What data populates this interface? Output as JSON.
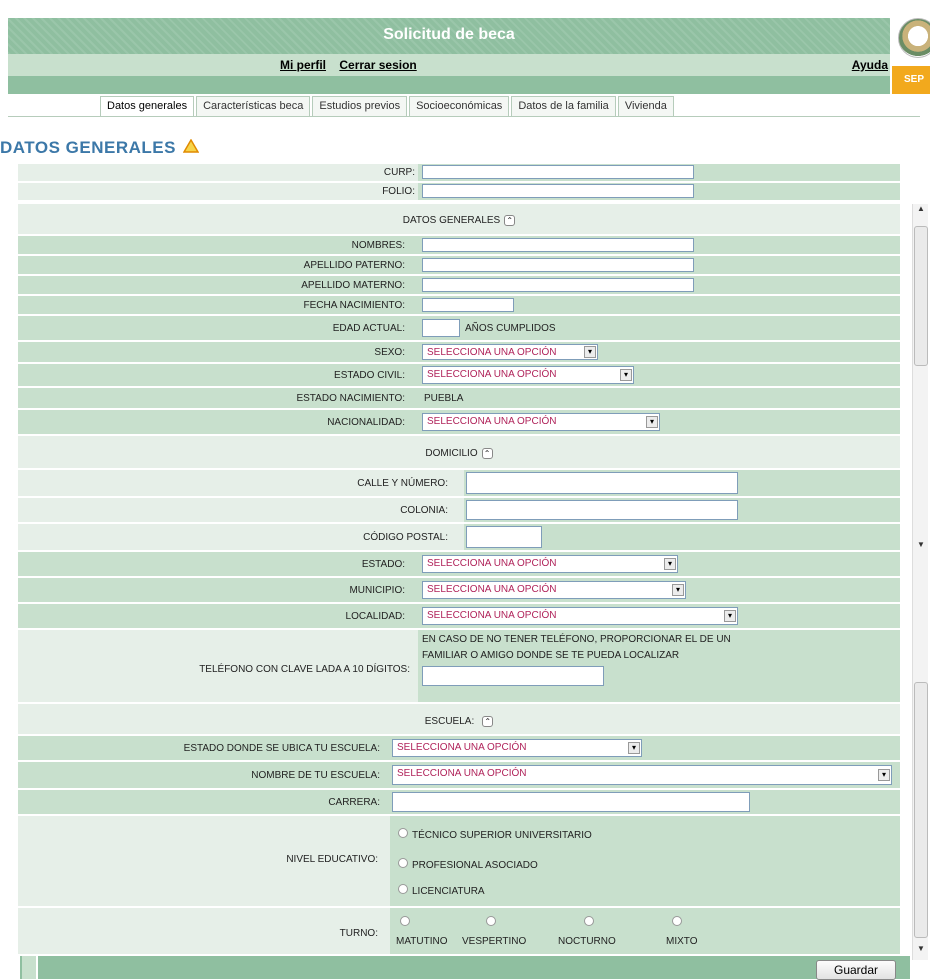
{
  "header": {
    "title": "Solicitud de beca",
    "nav": [
      "Mi perfil",
      "Cerrar sesion"
    ],
    "help": "Ayuda",
    "logo_strip_text": "SEP"
  },
  "tabs": [
    {
      "label": "Datos generales",
      "active": true
    },
    {
      "label": "Características beca"
    },
    {
      "label": "Estudios previos"
    },
    {
      "label": "Socioeconómicas"
    },
    {
      "label": "Datos de la familia"
    },
    {
      "label": "Vivienda"
    }
  ],
  "section_title": "DATOS GENERALES",
  "top": {
    "curp_label": "CURP:",
    "folio_label": "FOLIO:"
  },
  "personal": {
    "heading": "DATOS GENERALES",
    "nombres_label": "NOMBRES:",
    "apellido_paterno_label": "APELLIDO PATERNO:",
    "apellido_materno_label": "APELLIDO MATERNO:",
    "fecha_nacimiento_label": "FECHA NACIMIENTO:",
    "edad_label": "EDAD ACTUAL:",
    "edad_suffix": "AÑOS CUMPLIDOS",
    "sexo_label": "SEXO:",
    "sexo_value": "SELECCIONA UNA OPCIÓN",
    "estado_civil_label": "ESTADO CIVIL:",
    "estado_civil_value": "SELECCIONA UNA OPCIÓN",
    "estado_nacimiento_label": "ESTADO NACIMIENTO:",
    "estado_nacimiento_value": "PUEBLA",
    "nacionalidad_label": "NACIONALIDAD:",
    "nacionalidad_value": "SELECCIONA UNA OPCIÓN"
  },
  "domicilio": {
    "heading": "DOMICILIO",
    "calle_label": "CALLE Y NÚMERO:",
    "colonia_label": "COLONIA:",
    "cp_label": "CÓDIGO POSTAL:",
    "estado_label": "ESTADO:",
    "estado_value": "SELECCIONA UNA OPCIÓN",
    "municipio_label": "MUNICIPIO:",
    "municipio_value": "SELECCIONA UNA OPCIÓN",
    "localidad_label": "LOCALIDAD:",
    "localidad_value": "SELECCIONA UNA OPCIÓN",
    "telefono_label": "TELÉFONO CON CLAVE LADA A 10 DÍGITOS:",
    "telefono_note_1": "EN CASO DE NO TENER TELÉFONO, PROPORCIONAR EL DE UN",
    "telefono_note_2": "FAMILIAR O AMIGO DONDE SE TE PUEDA LOCALIZAR"
  },
  "escuela": {
    "heading": "ESCUELA:",
    "estado_label": "ESTADO DONDE SE UBICA TU ESCUELA:",
    "estado_value": "SELECCIONA UNA OPCIÓN",
    "nombre_label": "NOMBRE DE TU ESCUELA:",
    "nombre_value": "SELECCIONA UNA OPCIÓN",
    "carrera_label": "CARRERA:",
    "nivel_label": "NIVEL EDUCATIVO:",
    "nivel_options": [
      "TÉCNICO SUPERIOR UNIVERSITARIO",
      "PROFESIONAL ASOCIADO",
      "LICENCIATURA"
    ],
    "turno_label": "TURNO:",
    "turno_options": [
      "MATUTINO",
      "VESPERTINO",
      "NOCTURNO",
      "MIXTO"
    ]
  },
  "footer": {
    "save_label": "Guardar"
  },
  "colors": {
    "header_green": "#8fbfa0",
    "row_green": "#c8e0cd",
    "heading_blue": "#3c78a8",
    "select_text": "#b0235a",
    "warning_orange": "#f2a91d"
  },
  "icons": [
    "warning-icon",
    "collapse-icon",
    "dropdown-arrow-icon",
    "seal-logo"
  ]
}
